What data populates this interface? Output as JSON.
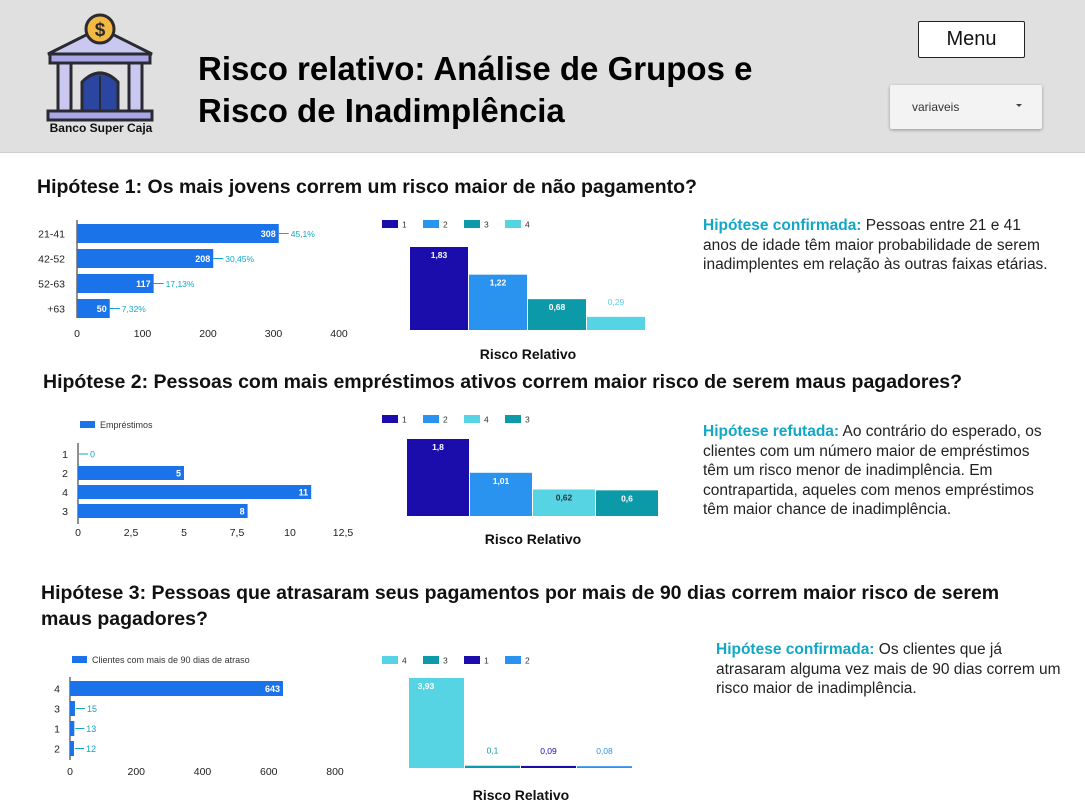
{
  "header": {
    "bank_name": "Banco Super Caja",
    "title_line1": "Risco relativo: Análise de Grupos e",
    "title_line2": "Risco de Inadimplência",
    "menu_label": "Menu",
    "dropdown_label": "variaveis",
    "logo_icon": "bank-dollar-icon"
  },
  "colors": {
    "bar_blue": "#1a73e8",
    "rr_1": "#1a0dab",
    "rr_2": "#2a93ef",
    "rr_3": "#0d9aa8",
    "rr_4": "#56d4e4",
    "highlight": "#12a7c6"
  },
  "hypotheses": [
    {
      "title": "Hipótese 1: Os mais jovens correm um risco maior de não pagamento?",
      "conclusion_label": "Hipótese confirmada:",
      "conclusion_text": " Pessoas entre 21 e 41 anos de idade têm maior probabilidade de serem inadimplentes em relação às outras faixas etárias."
    },
    {
      "title": "Hipótese 2: Pessoas com mais empréstimos ativos correm maior risco de serem maus pagadores?",
      "conclusion_label": "Hipótese refutada:",
      "conclusion_text": " Ao contrário do esperado, os clientes com um número maior de empréstimos têm um risco menor de inadimplência. Em contrapartida, aqueles com menos empréstimos têm maior chance de inadimplência."
    },
    {
      "title": "Hipótese 3: Pessoas que atrasaram seus pagamentos por mais de 90 dias correm maior risco de serem maus pagadores?",
      "conclusion_label": "Hipótese confirmada:",
      "conclusion_text": " Os clientes que já atrasaram alguma vez mais de 90 dias correm um risco maior de inadimplência."
    }
  ],
  "chart_data": [
    {
      "type": "bar",
      "orientation": "horizontal",
      "categories": [
        "21-41",
        "42-52",
        "52-63",
        "+63"
      ],
      "values": [
        308,
        208,
        117,
        50
      ],
      "value_labels": [
        "308",
        "208",
        "117",
        "50"
      ],
      "annotations": [
        "45,1%",
        "30,45%",
        "17,13%",
        "7,32%"
      ],
      "xlim": [
        0,
        400
      ],
      "x_ticks": [
        "0",
        "100",
        "200",
        "300",
        "400"
      ],
      "legend": null,
      "grid": false
    },
    {
      "type": "bar",
      "categories": [
        "1",
        "2",
        "3",
        "4"
      ],
      "values": [
        1.83,
        1.22,
        0.68,
        0.29
      ],
      "value_labels": [
        "1,83",
        "1,22",
        "0,68",
        "0,29"
      ],
      "legend": [
        "1",
        "2",
        "3",
        "4"
      ],
      "legend_position": "top",
      "xlabel": "Risco Relativo",
      "ylim": [
        0,
        1.83
      ]
    },
    {
      "type": "bar",
      "orientation": "horizontal",
      "categories": [
        "1",
        "2",
        "4",
        "3"
      ],
      "values": [
        0,
        5,
        11,
        8
      ],
      "value_labels": [
        "0",
        "5",
        "11",
        "8"
      ],
      "xlim": [
        0,
        12.5
      ],
      "x_ticks": [
        "0",
        "2,5",
        "5",
        "7,5",
        "10",
        "12,5"
      ],
      "legend": [
        "Empréstimos"
      ],
      "legend_position": "top-left",
      "grid": false
    },
    {
      "type": "bar",
      "categories": [
        "1",
        "2",
        "4",
        "3"
      ],
      "values": [
        1.8,
        1.01,
        0.62,
        0.6
      ],
      "value_labels": [
        "1,8",
        "1,01",
        "0,62",
        "0,6"
      ],
      "legend": [
        "1",
        "2",
        "4",
        "3"
      ],
      "legend_position": "top",
      "xlabel": "Risco Relativo",
      "ylim": [
        0,
        1.8
      ]
    },
    {
      "type": "bar",
      "orientation": "horizontal",
      "categories": [
        "4",
        "3",
        "1",
        "2"
      ],
      "values": [
        643,
        15,
        13,
        12
      ],
      "value_labels": [
        "643",
        "15",
        "13",
        "12"
      ],
      "xlim": [
        0,
        800
      ],
      "x_ticks": [
        "0",
        "200",
        "400",
        "600",
        "800"
      ],
      "legend": [
        "Clientes com mais de 90 dias de atraso"
      ],
      "legend_position": "top-left",
      "grid": false
    },
    {
      "type": "bar",
      "categories": [
        "4",
        "3",
        "1",
        "2"
      ],
      "values": [
        3.93,
        0.1,
        0.09,
        0.08
      ],
      "value_labels": [
        "3,93",
        "0,1",
        "0,09",
        "0,08"
      ],
      "legend": [
        "4",
        "3",
        "1",
        "2"
      ],
      "legend_position": "top",
      "xlabel": "Risco Relativo",
      "ylim": [
        0,
        3.93
      ]
    }
  ]
}
